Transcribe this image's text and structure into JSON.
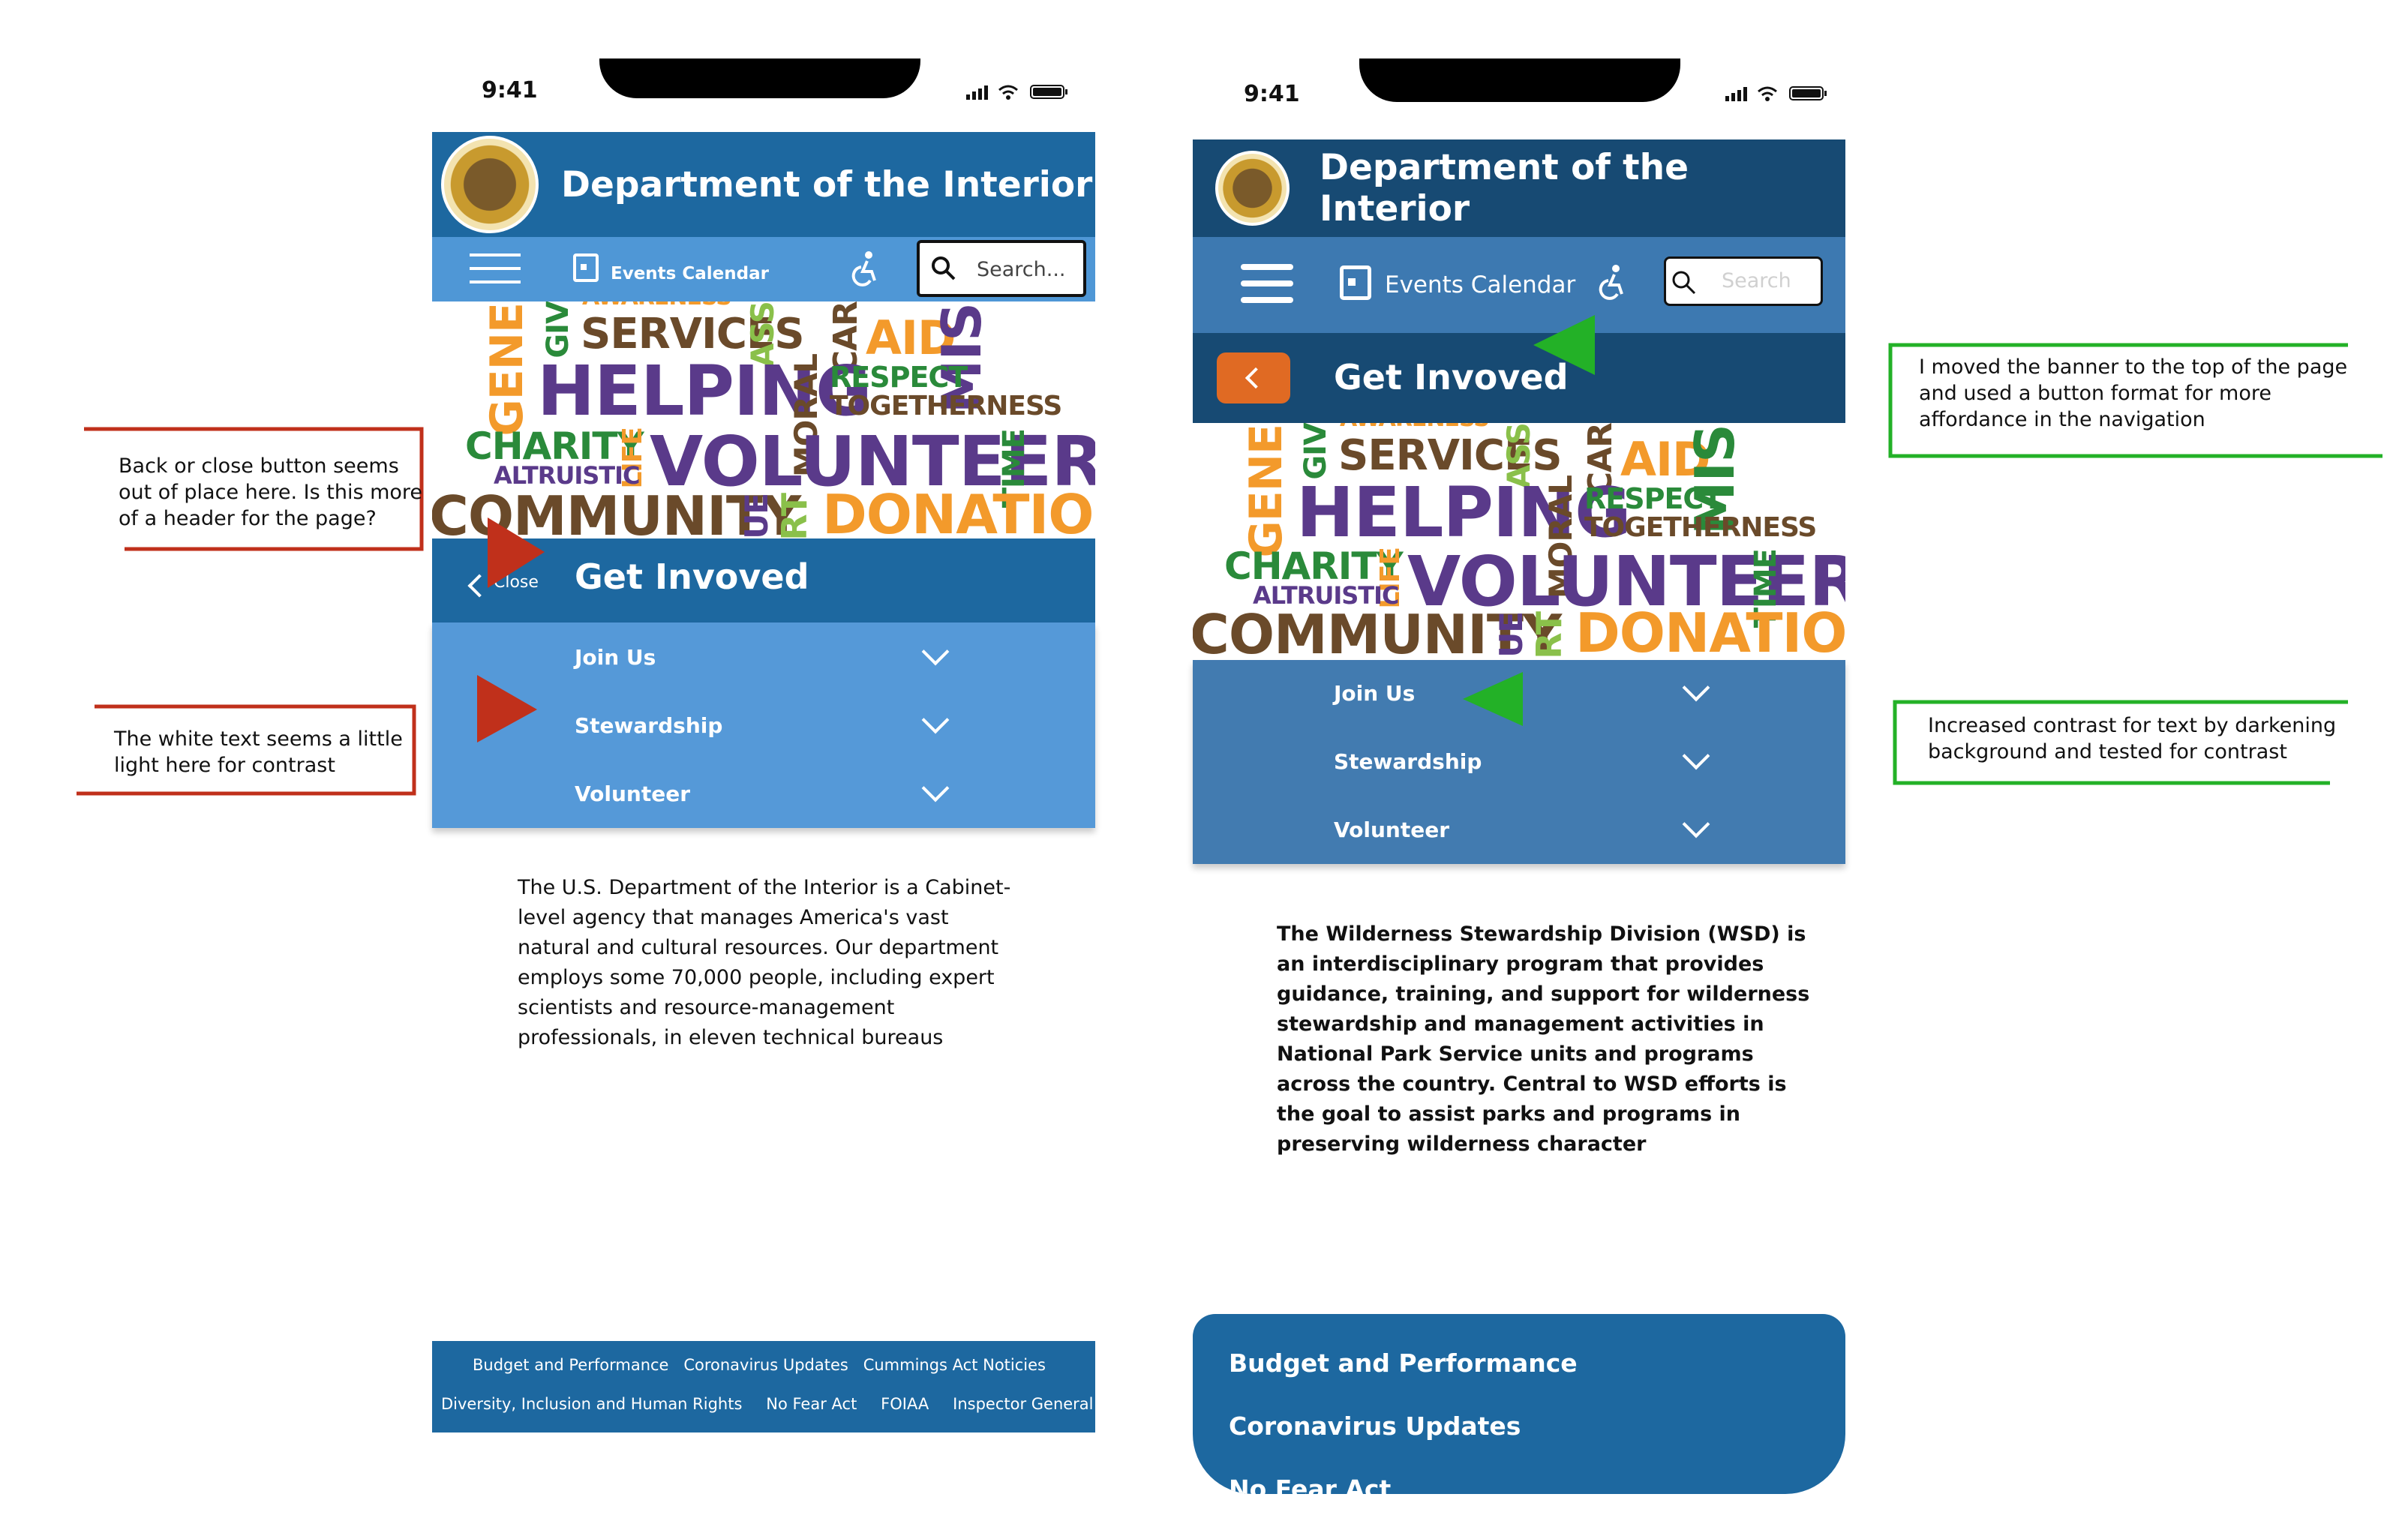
{
  "left_phone": {
    "status_time": "9:41",
    "header_title": "Department of the Interior",
    "nav": {
      "events_label": "Events Calendar",
      "search_placeholder": "Search..."
    },
    "wordcloud": [
      "GENE",
      "GIV",
      "AWARENESS",
      "SERVICES",
      "ASS",
      "CAR",
      "AID",
      "MIS",
      "HELPING",
      "MORAL",
      "RESPECT",
      "TOGETHERNESS",
      "CHARITY",
      "LIFE",
      "VOLUNTEER",
      "TIME",
      "ALTRUISTIC",
      "COMMUNITY",
      "UE",
      "RT",
      "DONATIONS"
    ],
    "close_label": "Close",
    "section_title": "Get Invoved",
    "menu_items": [
      "Join Us",
      "Stewardship",
      "Volunteer"
    ],
    "body_lines": [
      "The U.S. Department of the Interior is a Cabinet-",
      "level agency that manages America's vast",
      "natural and cultural resources. Our department",
      "employs some 70,000 people, including expert",
      "scientists and resource-management",
      "professionals, in eleven technical bureaus"
    ],
    "footer_row1": [
      "Budget and Performance",
      "Coronavirus Updates",
      "Cummings Act Noticies"
    ],
    "footer_row2": [
      "Diversity, Inclusion and Human Rights",
      "No Fear Act",
      "FOIAA",
      "Inspector General"
    ]
  },
  "right_phone": {
    "status_time": "9:41",
    "header_title": "Department of the Interior",
    "nav": {
      "events_label": "Events Calendar",
      "search_placeholder": "Search"
    },
    "section_title": "Get Invoved",
    "wordcloud": [
      "GENE",
      "GIV",
      "AWARENESS",
      "SERVICES",
      "ASS",
      "CAR",
      "AID",
      "MIS",
      "HELPING",
      "MORAL",
      "RESPECT",
      "TOGETHERNESS",
      "CHARITY",
      "LIFE",
      "VOLUNTEER",
      "TIME",
      "ALTRUISTIC",
      "COMMUNITY",
      "UE",
      "RT",
      "DONATIONS"
    ],
    "menu_items": [
      "Join Us",
      "Stewardship",
      "Volunteer"
    ],
    "body_lines": [
      "The Wilderness Stewardship Division (WSD) is",
      "an interdisciplinary program that provides",
      "guidance, training, and support for wilderness",
      "stewardship and management activities in",
      "National Park Service units and programs",
      "across the country. Central to WSD efforts is",
      "the goal to assist parks and programs in",
      "preserving wilderness character"
    ],
    "footer_links": [
      "Budget and Performance",
      "Coronavirus Updates",
      "No Fear Act"
    ]
  },
  "annotations": {
    "left_top": [
      "Back  or close button seems",
      "out of place here. Is this more",
      "of a header for the page?"
    ],
    "left_bottom": [
      "The white text seems a little",
      "light here for contrast"
    ],
    "right_top": [
      "I moved the banner to the top of the page",
      "and used a button format for more",
      "affordance in the navigation"
    ],
    "right_bottom": [
      "Increased contrast for text by darkening",
      "background and tested for contrast"
    ]
  },
  "colors": {
    "header_blue": "#1d68a0",
    "nav_light_blue": "#4f97d6",
    "right_dark_blue": "#174a73",
    "right_nav_blue": "#3d79b1",
    "right_menu_blue": "#427bb0",
    "orange_button": "#e06a23",
    "red_annotation": "#c0301b",
    "green_annotation": "#23b127"
  }
}
